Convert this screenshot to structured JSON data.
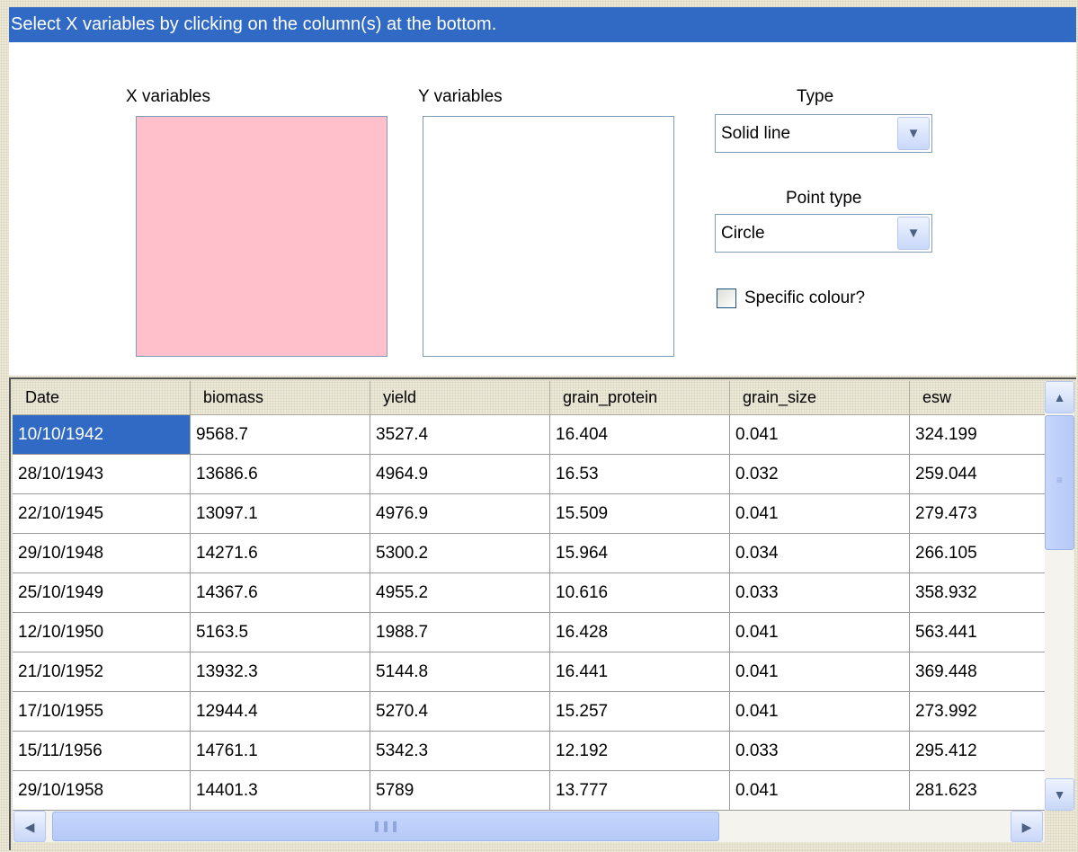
{
  "header": {
    "instruction": "Select X variables by clicking on the column(s) at the bottom."
  },
  "x_variables": {
    "label": "X variables",
    "bg_color": "#ffc0cb"
  },
  "y_variables": {
    "label": "Y variables"
  },
  "type": {
    "label": "Type",
    "value": "Solid line"
  },
  "point_type": {
    "label": "Point type",
    "value": "Circle"
  },
  "specific_colour": {
    "label": "Specific colour?",
    "checked": false
  },
  "table": {
    "columns": [
      "Date",
      "biomass",
      "yield",
      "grain_protein",
      "grain_size",
      "esw"
    ],
    "selected_cell": {
      "row": 0,
      "col": 0
    },
    "rows": [
      [
        "10/10/1942",
        "9568.7",
        "3527.4",
        "16.404",
        "0.041",
        "324.199"
      ],
      [
        "28/10/1943",
        "13686.6",
        "4964.9",
        "16.53",
        "0.032",
        "259.044"
      ],
      [
        "22/10/1945",
        "13097.1",
        "4976.9",
        "15.509",
        "0.041",
        "279.473"
      ],
      [
        "29/10/1948",
        "14271.6",
        "5300.2",
        "15.964",
        "0.034",
        "266.105"
      ],
      [
        "25/10/1949",
        "14367.6",
        "4955.2",
        "10.616",
        "0.033",
        "358.932"
      ],
      [
        "12/10/1950",
        "5163.5",
        "1988.7",
        "16.428",
        "0.041",
        "563.441"
      ],
      [
        "21/10/1952",
        "13932.3",
        "5144.8",
        "16.441",
        "0.041",
        "369.448"
      ],
      [
        "17/10/1955",
        "12944.4",
        "5270.4",
        "15.257",
        "0.041",
        "273.992"
      ],
      [
        "15/11/1956",
        "14761.1",
        "5342.3",
        "12.192",
        "0.033",
        "295.412"
      ],
      [
        "29/10/1958",
        "14401.3",
        "5789",
        "13.777",
        "0.041",
        "281.623"
      ]
    ]
  }
}
